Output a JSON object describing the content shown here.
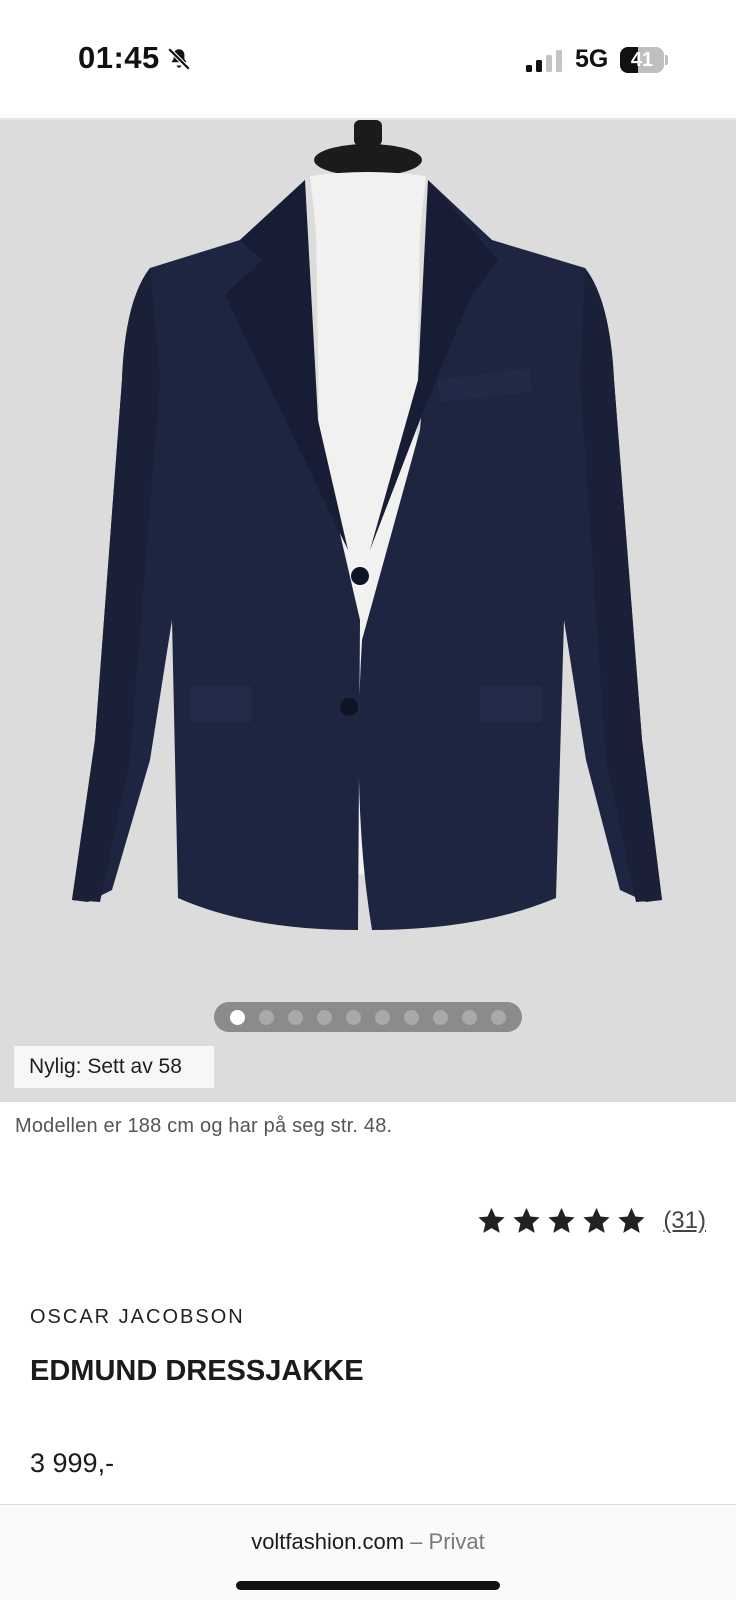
{
  "status_bar": {
    "time": "01:45",
    "network": "5G",
    "battery_level": "41",
    "battery_fraction": 0.41,
    "icons": [
      "bell-slash-icon",
      "signal-icon",
      "battery-icon"
    ]
  },
  "gallery": {
    "image": "navy-suit-jacket-on-mannequin",
    "background_color": "#dcdcdd",
    "total_images": 10,
    "active_index": 0,
    "recent_badge": "Nylig: Sett av 58"
  },
  "model_note": "Modellen er 188 cm og har på seg str. 48.",
  "rating": {
    "stars": 5,
    "count_label": "(31)"
  },
  "product": {
    "brand": "OSCAR JACOBSON",
    "title": "EDMUND DRESSJAKKE",
    "price": "3 999,-"
  },
  "browser": {
    "domain": "voltfashion.com",
    "mode": "Privat",
    "separator": "–"
  },
  "colors": {
    "jacket_navy": "#1e2540",
    "text_dark": "#1b1b1b",
    "star": "#222222"
  }
}
